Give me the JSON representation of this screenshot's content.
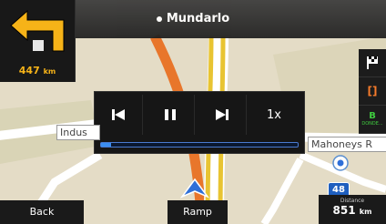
{
  "header": {
    "street": "Mundarlo"
  },
  "turn": {
    "distance_value": "447",
    "distance_unit": "km",
    "icon": "turn-left-arrow-icon"
  },
  "map": {
    "labels": {
      "left_road": "Indus",
      "right_road": "Mahoneys R"
    },
    "route_shield": "48",
    "colors": {
      "route": "#e8c432",
      "road_orange": "#e8762b"
    }
  },
  "player": {
    "controls": {
      "prev": "previous",
      "pause": "pause",
      "next": "next"
    },
    "speed": "1x",
    "progress": 0.05
  },
  "side_buttons": {
    "destination": "destination-flag-icon",
    "lane": "[]",
    "b": "B",
    "b_caption": "DONDE..."
  },
  "bottom": {
    "back_label": "Back",
    "ramp_label": "Ramp",
    "distance_caption": "Distance",
    "distance_value": "851",
    "distance_unit": "km"
  }
}
